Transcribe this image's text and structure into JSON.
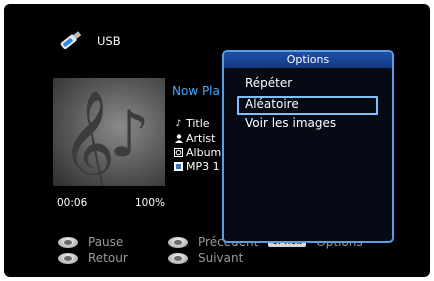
{
  "source": {
    "label": "USB",
    "icon": "usb-stick-icon"
  },
  "player": {
    "now_playing": "Now Pla",
    "title": "Title",
    "artist": "Artist",
    "album": "Album",
    "format": "MP3 1",
    "elapsed": "00:06",
    "progress_percent": "100%"
  },
  "hints": {
    "pause": "Pause",
    "back": "Retour",
    "previous": "Précédent",
    "next": "Suivant",
    "option_chip": "OPTION",
    "options": "Options"
  },
  "dialog": {
    "title": "Options",
    "items": [
      {
        "label": "Répéter",
        "selected": false
      },
      {
        "label": "Aléatoire",
        "selected": true
      },
      {
        "label": "Voir les images",
        "selected": false
      }
    ]
  },
  "colors": {
    "accent_blue": "#4aa8ff",
    "dialog_border": "#5b9ee8",
    "selection": "#7fbfff"
  }
}
